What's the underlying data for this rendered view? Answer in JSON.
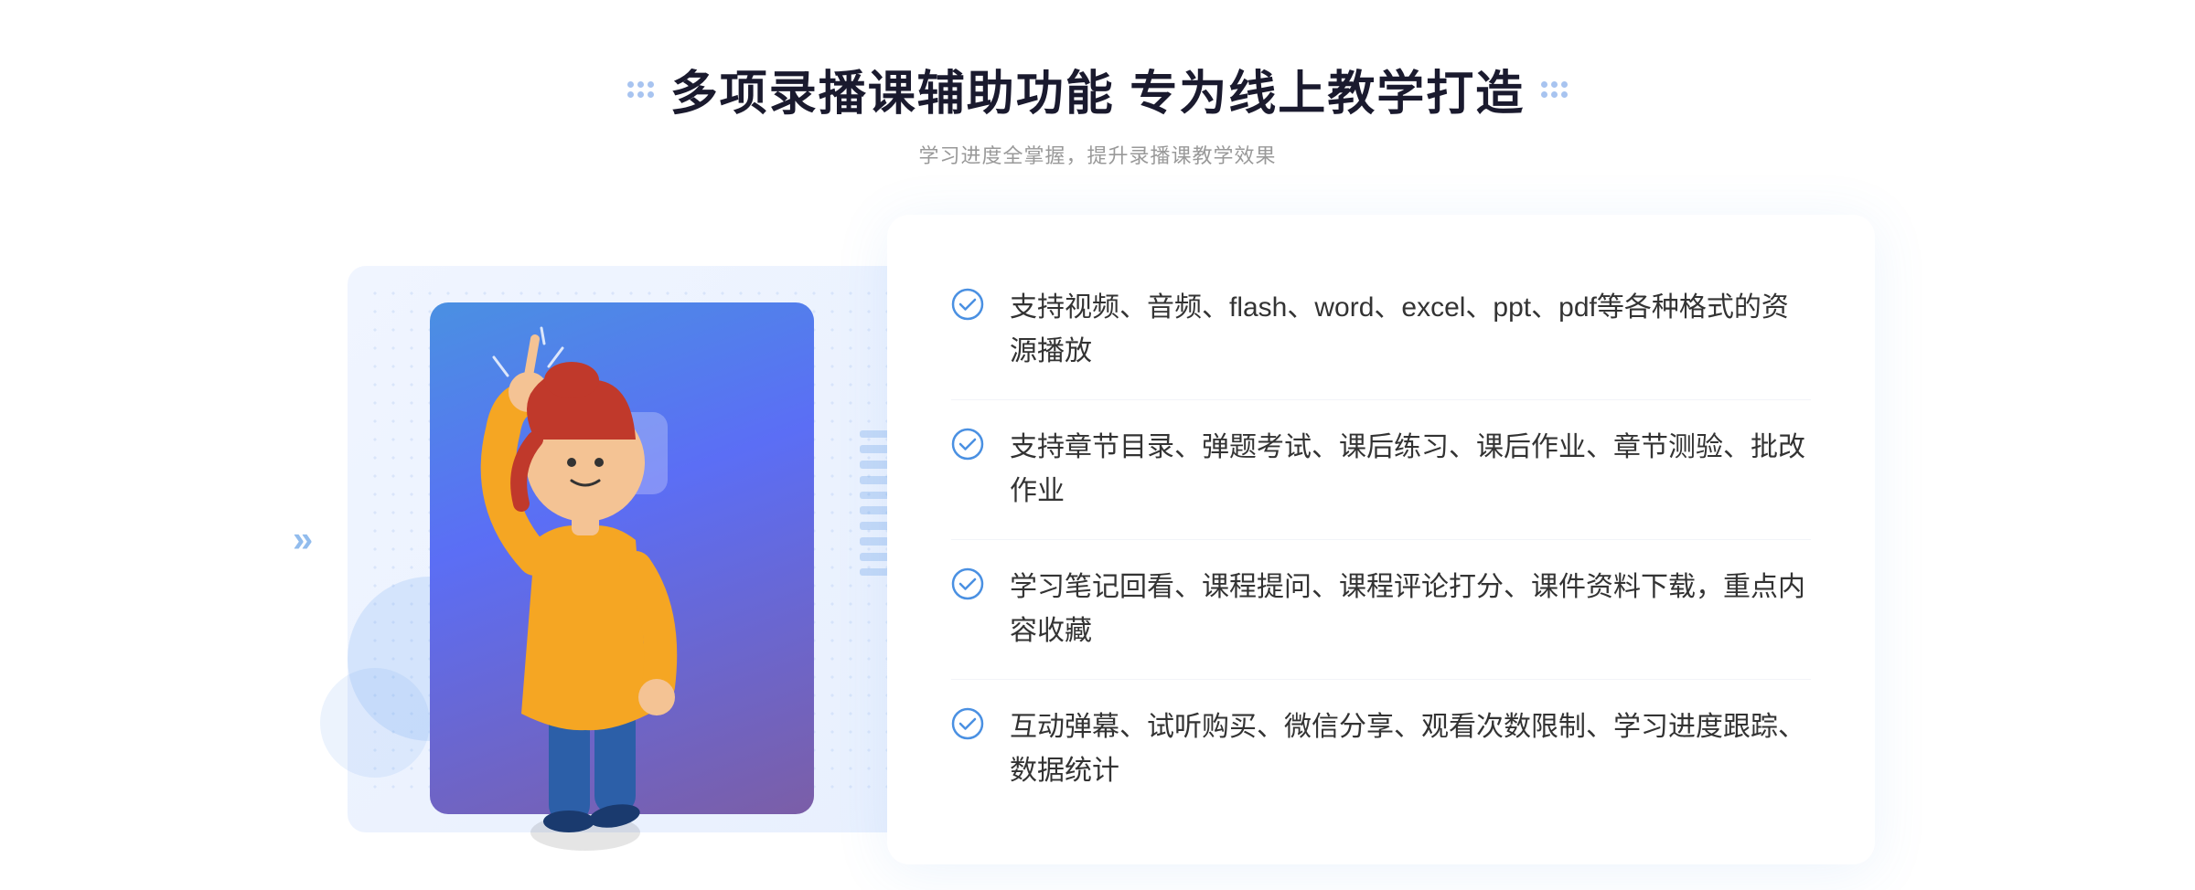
{
  "header": {
    "title": "多项录播课辅助功能 专为线上教学打造",
    "subtitle": "学习进度全掌握，提升录播课教学效果"
  },
  "features": [
    {
      "id": 1,
      "text": "支持视频、音频、flash、word、excel、ppt、pdf等各种格式的资源播放"
    },
    {
      "id": 2,
      "text": "支持章节目录、弹题考试、课后练习、课后作业、章节测验、批改作业"
    },
    {
      "id": 3,
      "text": "学习笔记回看、课程提问、课程评论打分、课件资料下载，重点内容收藏"
    },
    {
      "id": 4,
      "text": "互动弹幕、试听购买、微信分享、观看次数限制、学习进度跟踪、数据统计"
    }
  ]
}
